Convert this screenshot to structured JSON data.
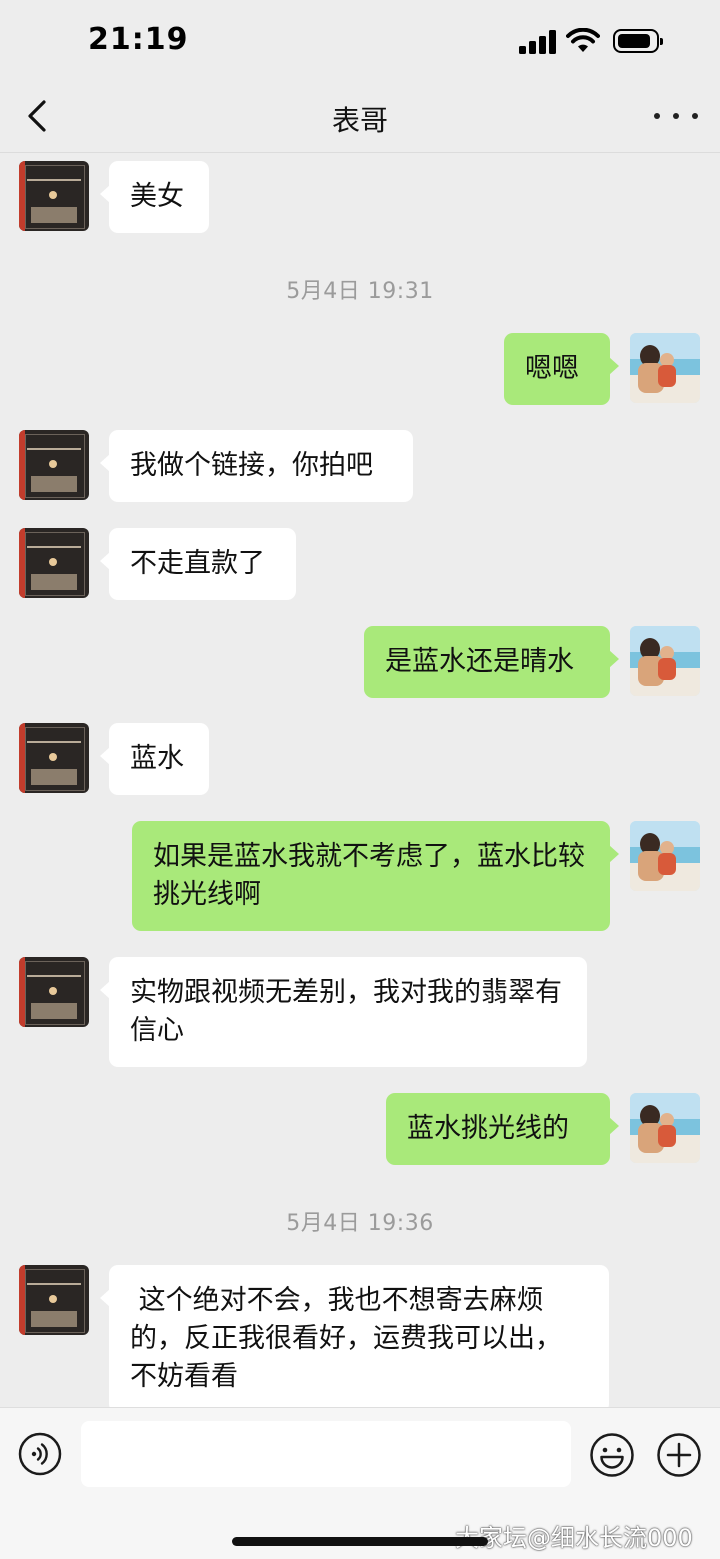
{
  "status_bar": {
    "time": "21:19",
    "battery_level": 0.9
  },
  "nav": {
    "title": "表哥",
    "back_icon": "chevron-left-icon",
    "more_icon": "ellipsis-icon"
  },
  "messages": [
    {
      "side": "left",
      "text": "美女"
    },
    {
      "type": "time",
      "text": "5月4日 19:31"
    },
    {
      "side": "right",
      "text": "嗯嗯"
    },
    {
      "side": "left",
      "text": "我做个链接，你拍吧"
    },
    {
      "side": "left",
      "text": "不走直款了"
    },
    {
      "side": "right",
      "text": "是蓝水还是晴水"
    },
    {
      "side": "left",
      "text": "蓝水"
    },
    {
      "side": "right",
      "text": "如果是蓝水我就不考虑了，蓝水比较挑光线啊"
    },
    {
      "side": "left",
      "text": "实物跟视频无差别，我对我的翡翠有信心"
    },
    {
      "side": "right",
      "text": "蓝水挑光线的"
    },
    {
      "type": "time",
      "text": "5月4日 19:36"
    },
    {
      "side": "left",
      "text": " 这个绝对不会，我也不想寄去麻烦的，反正我很看好，运费我可以出，不妨看看"
    }
  ],
  "input_bar": {
    "voice_icon": "voice-icon",
    "input_value": "",
    "emoji_icon": "emoji-icon",
    "plus_icon": "plus-icon"
  },
  "watermark": "大家坛@细水长流000",
  "colors": {
    "background": "#ededed",
    "bubble_self": "#a9e97a",
    "bubble_other": "#ffffff"
  }
}
